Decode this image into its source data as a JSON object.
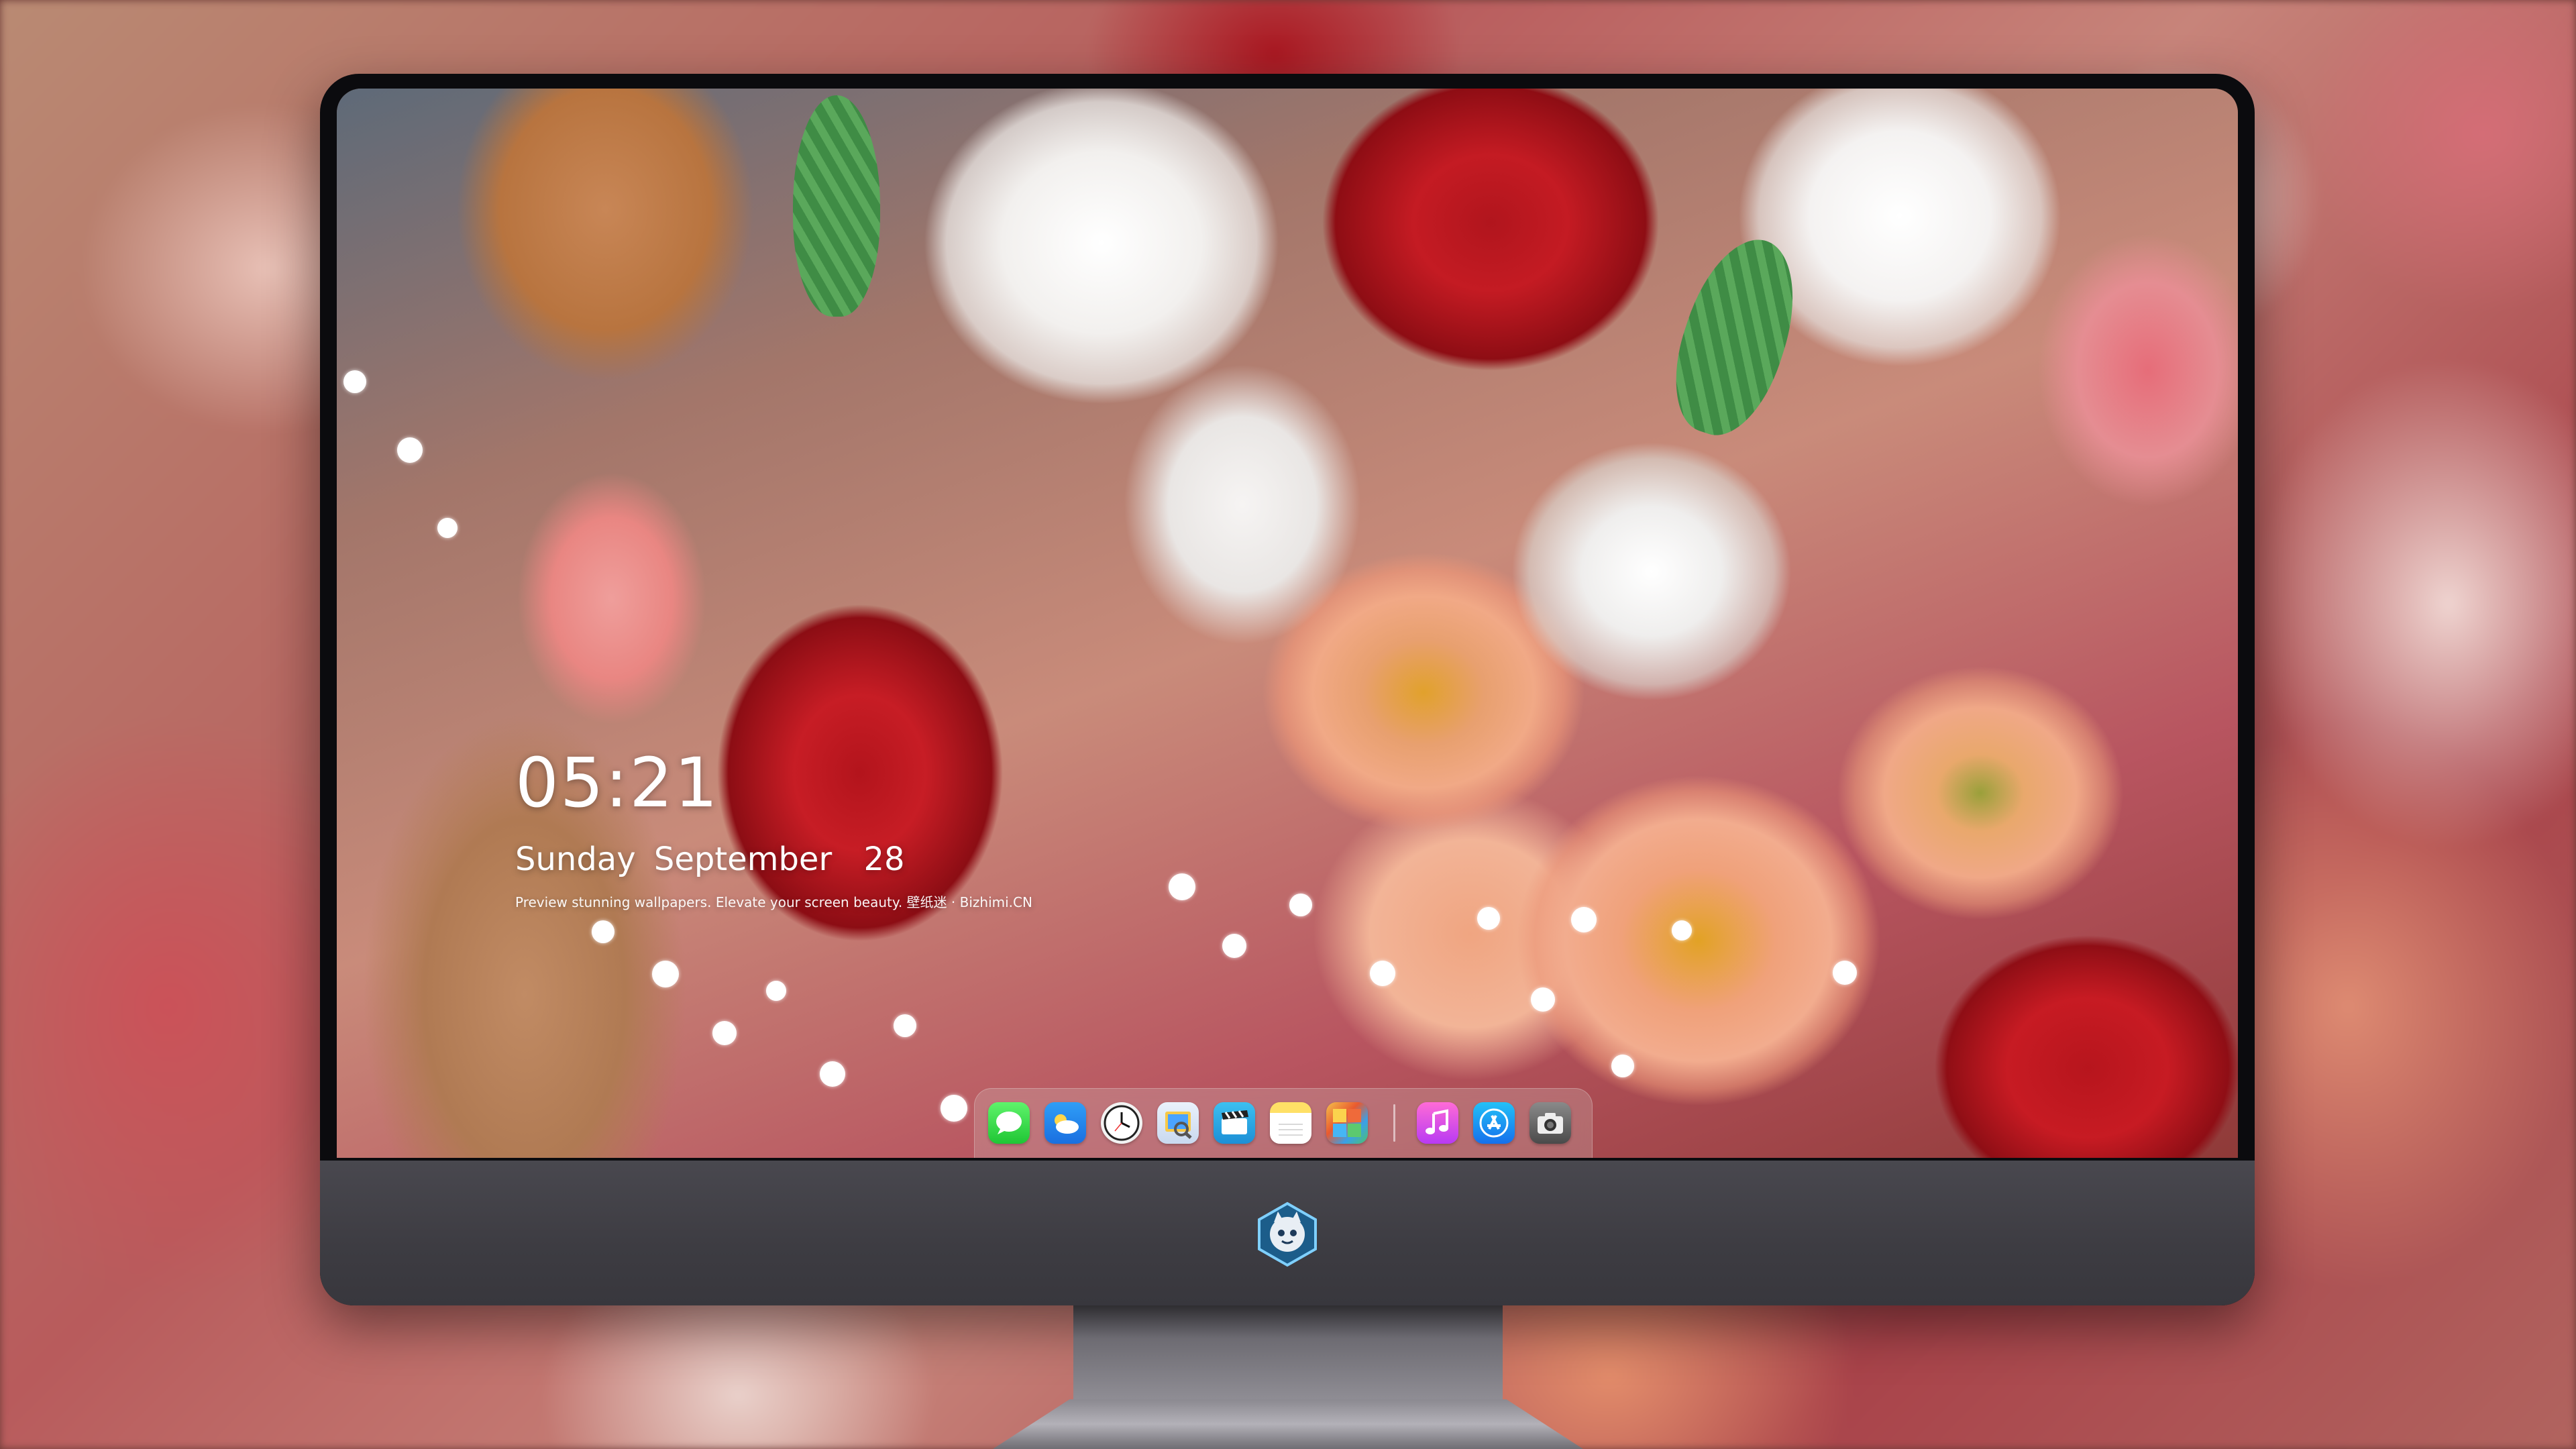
{
  "clock": {
    "time": "05:21",
    "day": "Sunday",
    "month": "September",
    "date": "28",
    "subtitle": "Preview stunning wallpapers. Elevate your screen beauty. 壁纸迷 · Bizhimi.CN"
  },
  "dock": {
    "apps": [
      {
        "name": "Messages",
        "icon": "messages-icon"
      },
      {
        "name": "Weather",
        "icon": "weather-icon"
      },
      {
        "name": "Clock",
        "icon": "clock-icon"
      },
      {
        "name": "Preview",
        "icon": "preview-icon"
      },
      {
        "name": "Clips",
        "icon": "clips-icon"
      },
      {
        "name": "Notes",
        "icon": "notes-icon"
      },
      {
        "name": "Photo Booth",
        "icon": "photo-booth-icon"
      }
    ],
    "pinned": [
      {
        "name": "Music",
        "icon": "music-icon"
      },
      {
        "name": "App Store",
        "icon": "app-store-icon"
      },
      {
        "name": "Camera",
        "icon": "camera-icon"
      }
    ]
  },
  "wallpaper": {
    "subject": "flower bouquet with red roses, white chrysanthemums, peach chrysanthemums and baby's breath"
  },
  "colors": {
    "monitor_bezel": "#0b0b0e",
    "monitor_chin": "#49484f",
    "text": "#ffffff"
  }
}
